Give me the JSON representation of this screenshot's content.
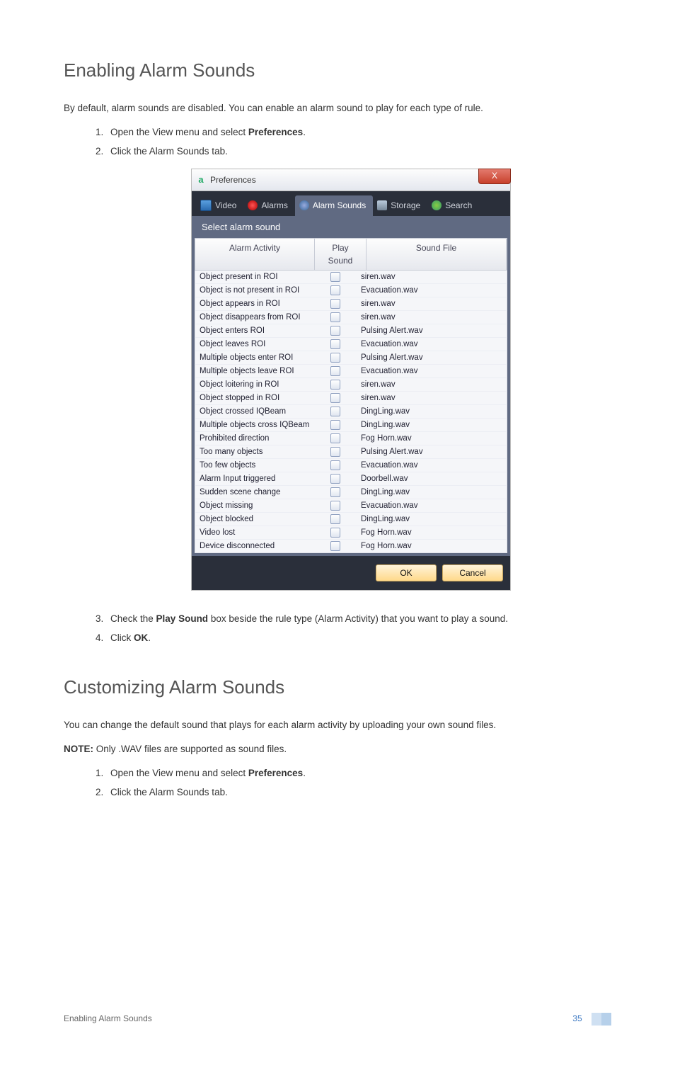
{
  "doc": {
    "section1": {
      "heading": "Enabling Alarm Sounds",
      "p1": "By default, alarm sounds are disabled. You can enable an alarm sound to play for each type of rule.",
      "step1_a": "Open the View menu and select ",
      "step1_b": "Preferences",
      "step1_c": ".",
      "step2": "Click the Alarm Sounds tab.",
      "step3_a": "Check the ",
      "step3_b": "Play Sound",
      "step3_c": " box beside the rule type (Alarm Activity) that you want to play a sound.",
      "step4_a": "Click ",
      "step4_b": "OK",
      "step4_c": "."
    },
    "section2": {
      "heading": "Customizing Alarm Sounds",
      "p1": "You can change the default sound that plays for each alarm activity by uploading your own sound files.",
      "note_label": "NOTE:",
      "note_text": " Only .WAV files are supported as sound files.",
      "step1_a": "Open the View menu and select ",
      "step1_b": "Preferences",
      "step1_c": ".",
      "step2": "Click the Alarm Sounds tab."
    },
    "footer_text": "Enabling Alarm Sounds",
    "page_number": "35"
  },
  "dialog": {
    "title": "Preferences",
    "close_glyph": "X",
    "tabs": {
      "video": "Video",
      "alarms": "Alarms",
      "alarm_sounds": "Alarm Sounds",
      "storage": "Storage",
      "search": "Search"
    },
    "panel_header": "Select alarm sound",
    "columns": {
      "activity": "Alarm Activity",
      "play": "Play Sound",
      "file": "Sound File"
    },
    "rows": [
      {
        "activity": "Object present in ROI",
        "file": "siren.wav"
      },
      {
        "activity": "Object is not present in ROI",
        "file": "Evacuation.wav"
      },
      {
        "activity": "Object appears in ROI",
        "file": "siren.wav"
      },
      {
        "activity": "Object disappears from ROI",
        "file": "siren.wav"
      },
      {
        "activity": "Object enters ROI",
        "file": "Pulsing Alert.wav"
      },
      {
        "activity": "Object leaves ROI",
        "file": "Evacuation.wav"
      },
      {
        "activity": "Multiple objects enter ROI",
        "file": "Pulsing Alert.wav"
      },
      {
        "activity": "Multiple objects leave ROI",
        "file": "Evacuation.wav"
      },
      {
        "activity": "Object loitering in ROI",
        "file": "siren.wav"
      },
      {
        "activity": "Object stopped in ROI",
        "file": "siren.wav"
      },
      {
        "activity": "Object crossed IQBeam",
        "file": "DingLing.wav"
      },
      {
        "activity": "Multiple objects cross IQBeam",
        "file": "DingLing.wav"
      },
      {
        "activity": "Prohibited direction",
        "file": "Fog Horn.wav"
      },
      {
        "activity": "Too many objects",
        "file": "Pulsing Alert.wav"
      },
      {
        "activity": "Too few objects",
        "file": "Evacuation.wav"
      },
      {
        "activity": "Alarm Input triggered",
        "file": "Doorbell.wav"
      },
      {
        "activity": "Sudden scene change",
        "file": "DingLing.wav"
      },
      {
        "activity": "Object missing",
        "file": "Evacuation.wav"
      },
      {
        "activity": "Object blocked",
        "file": "DingLing.wav"
      },
      {
        "activity": "Video lost",
        "file": "Fog Horn.wav"
      },
      {
        "activity": "Device disconnected",
        "file": "Fog Horn.wav"
      }
    ],
    "ok": "OK",
    "cancel": "Cancel"
  }
}
